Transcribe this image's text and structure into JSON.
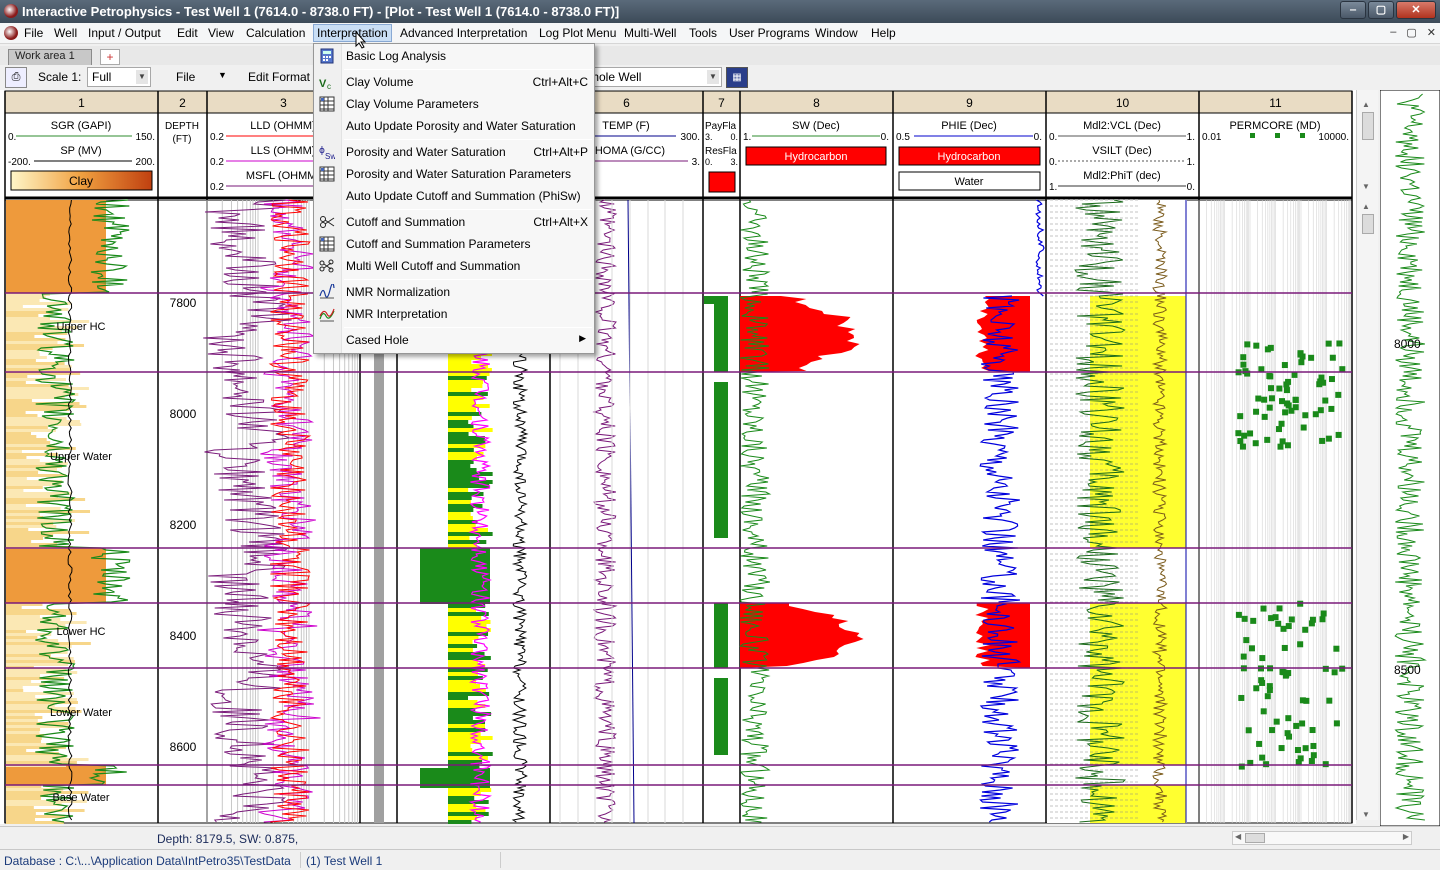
{
  "window": {
    "title": "Interactive Petrophysics  -  Test Well 1 (7614.0 - 8738.0 FT) - [Plot - Test Well 1 (7614.0 - 8738.0 FT)]",
    "minimize": "‒",
    "maximize": "▢",
    "close": "✕"
  },
  "menubar": {
    "items": [
      "File",
      "Well",
      "Input / Output",
      "Edit",
      "View",
      "Calculation",
      "Interpretation",
      "Advanced Interpretation",
      "Log Plot Menu",
      "Multi-Well",
      "Tools",
      "User Programs",
      "Window",
      "Help"
    ],
    "active": "Interpretation",
    "mdi_buttons": [
      "–",
      "▢",
      "✕"
    ]
  },
  "tabs": {
    "workarea": "Work area 1",
    "add": "+"
  },
  "toolbar": {
    "scale_label": "Scale 1:",
    "scale_value": "Full",
    "file_label": "File",
    "edit_format_label": "Edit Format",
    "range_value": "Whole Well"
  },
  "tracks": [
    {
      "number": "1",
      "curves": [
        {
          "name": "SGR (GAPI)",
          "min": "0.",
          "max": "150.",
          "color": "#2e8b2e"
        },
        {
          "name": "SP (MV)",
          "min": "-200.",
          "max": "200.",
          "color": "#000000"
        }
      ],
      "fill": {
        "label": "Clay",
        "type": "gradient"
      }
    },
    {
      "number": "2",
      "curves": [
        {
          "name": "DEPTH",
          "unit": "(FT)"
        }
      ]
    },
    {
      "number": "3",
      "curves": [
        {
          "name": "LLD (OHMM)",
          "min": "0.2",
          "color": "#ff0000"
        },
        {
          "name": "LLS (OHMM)",
          "min": "0.2",
          "color": "#cc00cc"
        },
        {
          "name": "MSFL (OHMM)",
          "min": "0.2",
          "color": "#7a1a7a"
        }
      ]
    },
    {
      "number": "4",
      "curves": []
    },
    {
      "number": "5",
      "curves": []
    },
    {
      "number": "6",
      "curves": [
        {
          "name": "TEMP (F)",
          "max": "300.",
          "color": "#00008b"
        },
        {
          "name": "RHOMA (G/CC)",
          "max": "3.",
          "color": "#7a1a7a"
        }
      ]
    },
    {
      "number": "7",
      "curves": [
        {
          "name": "PayFla",
          "min": "3.",
          "max": "0."
        },
        {
          "name": "ResFla",
          "min": "0.",
          "max": "3."
        }
      ]
    },
    {
      "number": "8",
      "curves": [
        {
          "name": "SW (Dec)",
          "min": "1.",
          "max": "0.",
          "color": "#2e8b2e"
        }
      ],
      "fill": {
        "label": "Hydrocarbon"
      }
    },
    {
      "number": "9",
      "curves": [
        {
          "name": "PHIE (Dec)",
          "min": "0.5",
          "max": "0.",
          "color": "#0000cc"
        }
      ],
      "fill": {
        "label": "Hydrocarbon",
        "label2": "Water"
      }
    },
    {
      "number": "10",
      "curves": [
        {
          "name": "Mdl2:VCL (Dec)",
          "min": "0.",
          "max": "1."
        },
        {
          "name": "VSILT (Dec)",
          "min": "0.",
          "max": "1."
        },
        {
          "name": "Mdl2:PhiT (dec)",
          "min": "1.",
          "max": "0."
        }
      ]
    },
    {
      "number": "11",
      "curves": [
        {
          "name": "PERMCORE (MD)",
          "min": "0.01",
          "max": "10000.",
          "color": "#1a8a1a"
        }
      ]
    }
  ],
  "depth_ticks": [
    "7800",
    "8000",
    "8200",
    "8400",
    "8600"
  ],
  "zones": [
    "Upper HC",
    "Upper Water",
    "Lower HC",
    "Lower Water",
    "Base Water"
  ],
  "overview": {
    "ticks": [
      "8000",
      "8500"
    ]
  },
  "status": {
    "depth_readout": "Depth: 8179.5,  SW: 0.875,"
  },
  "bottom": {
    "database": "Database : C:\\...\\Application Data\\IntPetro35\\TestData",
    "well": "(1) Test Well 1"
  },
  "interpretation_menu": [
    {
      "label": "Basic Log Analysis",
      "icon": "calculator-icon"
    },
    {
      "sep": true
    },
    {
      "label": "Clay Volume",
      "shortcut": "Ctrl+Alt+C",
      "icon": "vcl-icon"
    },
    {
      "label": "Clay Volume Parameters",
      "icon": "grid-params-icon"
    },
    {
      "label": "Auto Update Porosity and Water Saturation"
    },
    {
      "sep": true
    },
    {
      "label": "Porosity and Water Saturation",
      "shortcut": "Ctrl+Alt+P",
      "icon": "phi-sw-icon"
    },
    {
      "label": "Porosity and Water Saturation Parameters",
      "icon": "grid-params-icon"
    },
    {
      "label": "Auto Update Cutoff and Summation (PhiSw)"
    },
    {
      "sep": true
    },
    {
      "label": "Cutoff and Summation",
      "shortcut": "Ctrl+Alt+X",
      "icon": "scissors-icon"
    },
    {
      "label": "Cutoff and Summation Parameters",
      "icon": "grid-params-icon"
    },
    {
      "label": "Multi Well Cutoff and Summation",
      "icon": "multi-scissors-icon"
    },
    {
      "sep": true
    },
    {
      "label": "NMR Normalization",
      "icon": "nmr-norm-icon"
    },
    {
      "label": "NMR Interpretation",
      "icon": "nmr-interp-icon"
    },
    {
      "sep": true
    },
    {
      "label": "Cased Hole",
      "submenu": true
    }
  ]
}
